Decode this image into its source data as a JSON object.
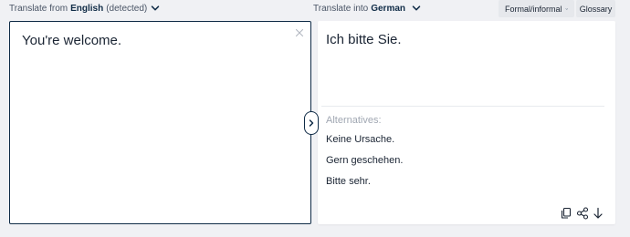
{
  "source_lang": {
    "prefix": "Translate from",
    "language": "English",
    "suffix": "(detected)"
  },
  "target_lang": {
    "prefix": "Translate into",
    "language": "German"
  },
  "toolbar": {
    "formal_label": "Formal/informal",
    "glossary_label": "Glossary"
  },
  "source": {
    "text": "You're welcome."
  },
  "target": {
    "text": "Ich bitte Sie.",
    "alternatives_label": "Alternatives:",
    "alternatives": [
      "Keine Ursache.",
      "Gern geschehen.",
      "Bitte sehr."
    ]
  },
  "icons": {
    "chevron": "chevron-down-icon",
    "clear": "close-icon",
    "swap": "chevron-right-icon",
    "copy": "copy-icon",
    "share": "share-icon",
    "download": "download-icon"
  },
  "colors": {
    "accent": "#0f2b46",
    "background": "#f0f1f4",
    "muted_text": "#a0a7b2"
  }
}
